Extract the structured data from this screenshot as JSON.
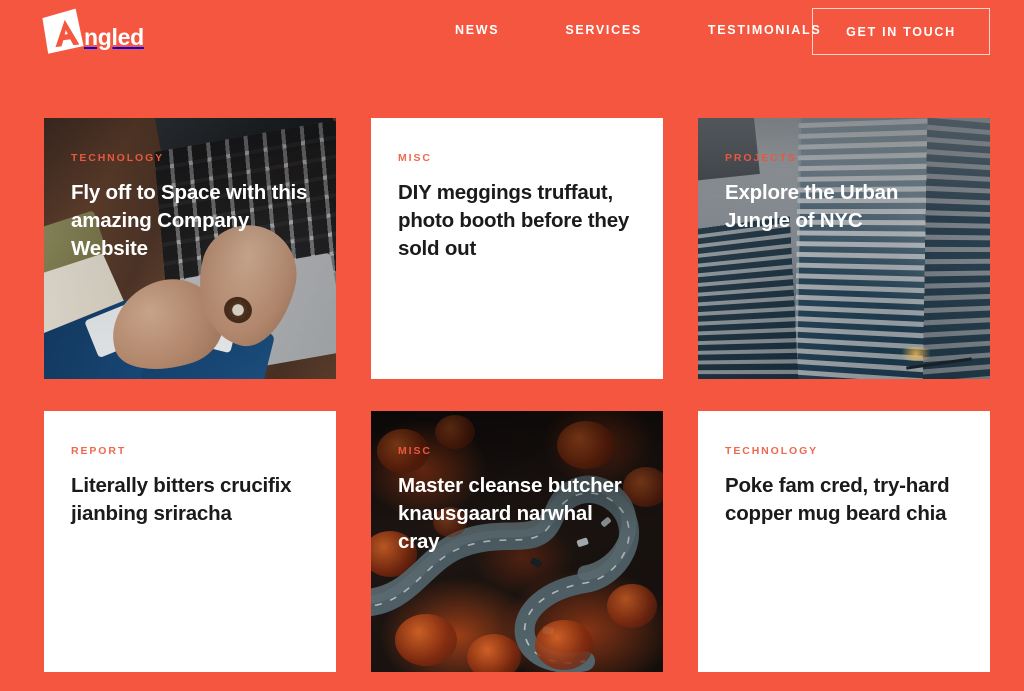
{
  "theme": {
    "background": "#F5563F",
    "card_background": "#FFFFFF",
    "accent_on_light": "#EE6A4F",
    "accent_on_dark": "#E9573F",
    "text_light": "#FFFFFF",
    "text_dark": "#1B1B1B"
  },
  "header": {
    "brand": {
      "name": "Angled",
      "mark_letter": "A",
      "word": "ngled"
    },
    "nav": [
      {
        "label": "News"
      },
      {
        "label": "Services"
      },
      {
        "label": "Testimonials"
      }
    ],
    "cta": {
      "label": "Get in Touch"
    }
  },
  "cards": [
    {
      "category": "Technology",
      "title": "Fly off to Space with this amazing Company Website",
      "style": "image",
      "image": "desk-laptop-hands-photo"
    },
    {
      "category": "Misc",
      "title": "DIY meggings truffaut, photo booth before they sold out",
      "style": "plain",
      "image": ""
    },
    {
      "category": "Projects",
      "title": "Explore the Urban Jungle of NYC",
      "style": "image",
      "image": "skyscrapers-photo"
    },
    {
      "category": "Report",
      "title": "Literally bitters crucifix jianbing sriracha",
      "style": "plain",
      "image": ""
    },
    {
      "category": "Misc",
      "title": "Master cleanse butcher knausgaard narwhal cray",
      "style": "image",
      "image": "aerial-winding-road-autumn-forest-photo"
    },
    {
      "category": "Technology",
      "title": "Poke fam cred, try-hard copper mug beard chia",
      "style": "plain",
      "image": ""
    }
  ]
}
